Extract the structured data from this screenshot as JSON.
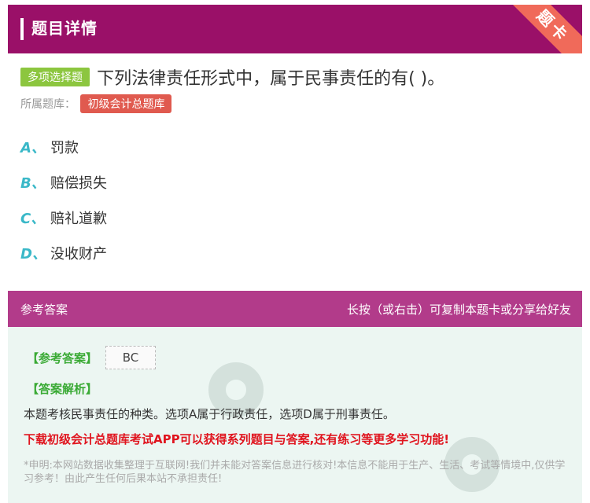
{
  "header": {
    "title": "题目详情",
    "ribbon": "题卡"
  },
  "question": {
    "type": "多项选择题",
    "text": "下列法律责任形式中，属于民事责任的有( )。",
    "bank_label": "所属题库：",
    "bank_name": "初级会计总题库"
  },
  "options": [
    {
      "letter": "A、",
      "text": "罚款"
    },
    {
      "letter": "B、",
      "text": "赔偿损失"
    },
    {
      "letter": "C、",
      "text": "赔礼道歉"
    },
    {
      "letter": "D、",
      "text": "没收财产"
    }
  ],
  "answer": {
    "header_left": "参考答案",
    "header_right": "长按（或右击）可复制本题卡或分享给好友",
    "ref_label": "【参考答案】",
    "ref_value": "BC",
    "analysis_label": "【答案解析】",
    "analysis_text": "本题考核民事责任的种类。选项A属于行政责任，选项D属于刑事责任。",
    "promo": "下载初级会计总题库考试APP可以获得系列题目与答案,还有练习等更多学习功能!",
    "disclaimer": "*申明:本网站数据收集整理于互联网!我们并未能对答案信息进行核对!本信息不能用于生产、生活、考试等情境中,仅供学习参考！由此产生任何后果本站不承担责任!"
  },
  "colors": {
    "header_bg": "#9a1068",
    "answer_header_bg": "#b23b8a",
    "option_letter": "#3ab8c8",
    "type_tag": "#8cc63f",
    "bank_tag": "#e05a4f",
    "promo": "#e0141e"
  }
}
